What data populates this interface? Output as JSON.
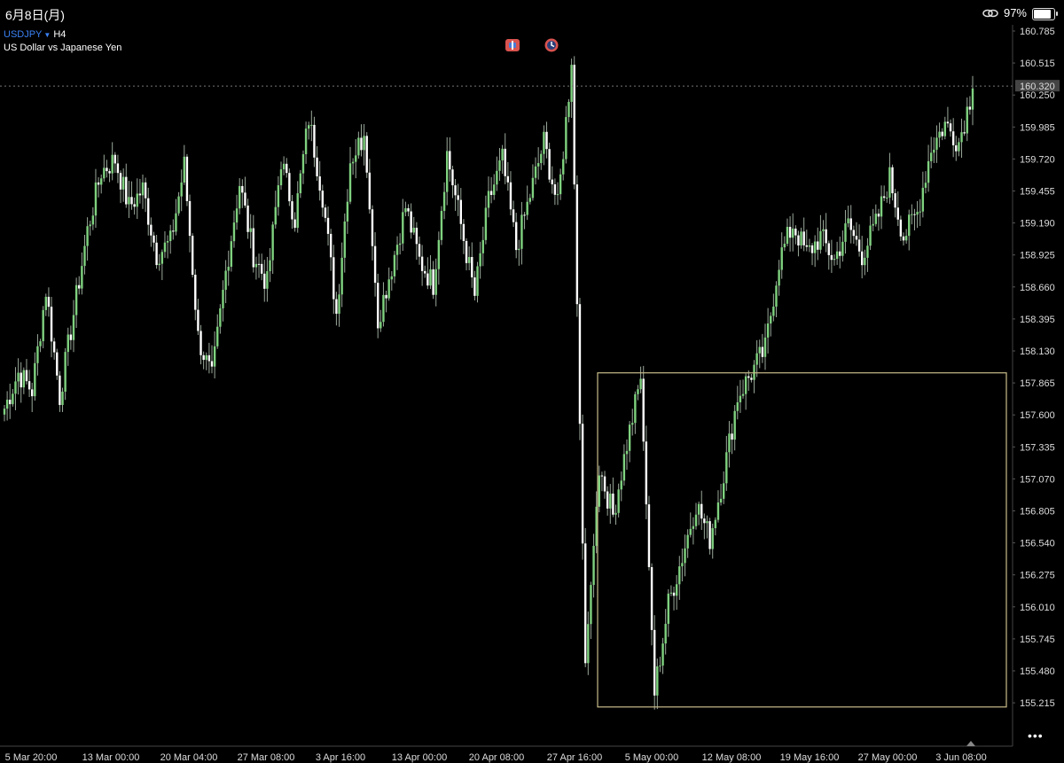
{
  "status_bar": {
    "date": "6月8日(月)",
    "battery": "97%",
    "battery_level": 0.97,
    "icons": [
      "link-icon",
      "battery-icon"
    ]
  },
  "chart_header": {
    "symbol": "USDJPY",
    "timeframe": "H4",
    "description": "US Dollar vs Japanese Yen",
    "tool_icons": [
      "indicator-icon",
      "clock-icon"
    ]
  },
  "more_menu": "•••",
  "colors": {
    "background": "#000000",
    "bull_candle": "#7fd17f",
    "bear_candle": "#ffffff",
    "rectangle": "#c8bc8a",
    "current_price_tag": "#444444",
    "symbol": "#3b82f6"
  },
  "chart_data": {
    "type": "candlestick",
    "symbol": "USDJPY",
    "timeframe": "H4",
    "y_ticks": [
      "160.785",
      "160.515",
      "160.250",
      "159.985",
      "159.720",
      "159.455",
      "159.190",
      "158.925",
      "158.660",
      "158.395",
      "158.130",
      "157.865",
      "157.600",
      "157.335",
      "157.070",
      "156.805",
      "156.540",
      "156.275",
      "156.010",
      "155.745",
      "155.480",
      "155.215"
    ],
    "ylim": [
      155.0,
      160.85
    ],
    "x_ticks": [
      "5 Mar 20:00",
      "13 Mar 00:00",
      "20 Mar 04:00",
      "27 Mar 08:00",
      "3 Apr 16:00",
      "13 Apr 00:00",
      "20 Apr 08:00",
      "27 Apr 16:00",
      "5 May 00:00",
      "12 May 08:00",
      "19 May 16:00",
      "27 May 00:00",
      "3 Jun 08:00"
    ],
    "current_price": "160.320",
    "current_price_value": 160.32,
    "close_path": [
      157.6,
      157.9,
      157.75,
      158.6,
      157.7,
      158.4,
      159.1,
      159.6,
      159.7,
      159.3,
      159.45,
      158.9,
      159.0,
      159.65,
      158.2,
      157.85,
      158.75,
      159.5,
      158.9,
      158.65,
      159.7,
      159.2,
      160.05,
      159.4,
      158.4,
      159.7,
      159.9,
      158.35,
      158.8,
      159.3,
      158.85,
      158.65,
      159.75,
      159.15,
      158.55,
      159.35,
      159.7,
      158.95,
      159.4,
      159.85,
      159.3,
      160.5,
      155.45,
      157.1,
      156.7,
      157.3,
      157.85,
      155.2,
      155.95,
      156.35,
      156.8,
      156.5,
      157.05,
      157.7,
      157.9,
      158.1,
      158.85,
      159.15,
      158.9,
      159.05,
      158.85,
      159.15,
      158.9,
      159.15,
      159.55,
      159.05,
      159.25,
      159.8,
      160.0,
      159.85,
      160.3
    ],
    "rectangle": {
      "start_date": "1 May",
      "end_date": "8 Jun",
      "top": 157.9,
      "bottom": 155.08
    },
    "grid": false,
    "legend": "none"
  }
}
